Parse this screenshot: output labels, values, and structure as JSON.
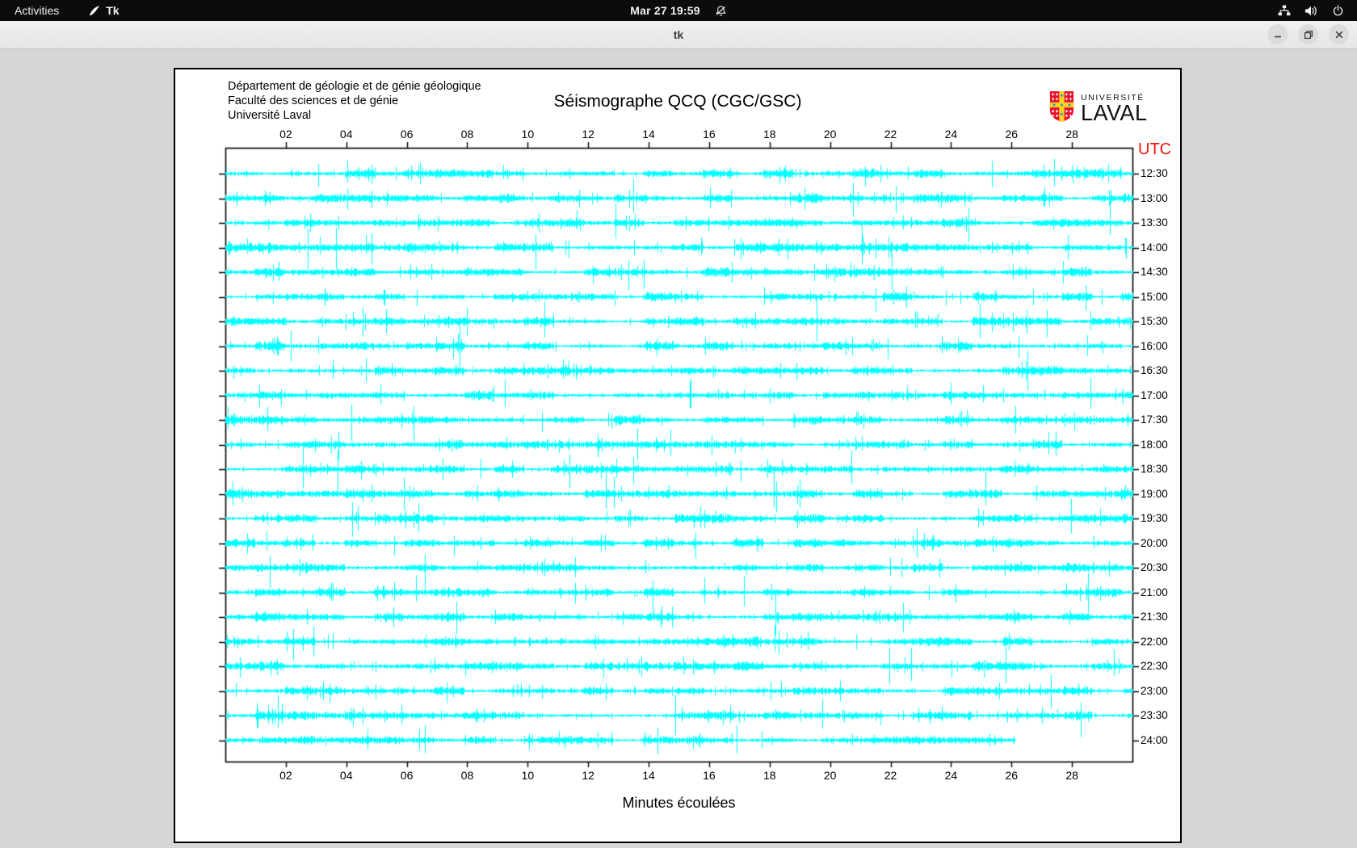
{
  "colors": {
    "trace": "#00ffff",
    "utc": "#f5120c",
    "logo_red": "#e8112d",
    "logo_gold": "#ffd21e",
    "logo_blue": "#2aa0d8",
    "topbar_bg": "#0c0c0c"
  },
  "top_bar": {
    "activities_label": "Activities",
    "app_label": "Tk",
    "clock": "Mar 27  19:59"
  },
  "titlebar": {
    "title": "tk"
  },
  "header": {
    "lines": [
      "Département de géologie et de génie géologique",
      "Faculté des sciences et de génie",
      "Université Laval"
    ],
    "logo_top": "UNIVERSITÉ",
    "logo_bottom": "LAVAL"
  },
  "chart_data": {
    "type": "line",
    "subtype": "helicorder-seismogram",
    "title": "Séismographe QCQ (CGC/GSC)",
    "xlabel": "Minutes écoulées",
    "right_axis_title": "UTC",
    "x_range": [
      0,
      30
    ],
    "x_ticks": [
      "02",
      "04",
      "06",
      "08",
      "10",
      "12",
      "14",
      "16",
      "18",
      "20",
      "22",
      "24",
      "26",
      "28"
    ],
    "row_labels": [
      "12:30",
      "13:00",
      "13:30",
      "14:00",
      "14:30",
      "15:00",
      "15:30",
      "16:00",
      "16:30",
      "17:00",
      "17:30",
      "18:00",
      "18:30",
      "19:00",
      "19:30",
      "20:00",
      "20:30",
      "21:00",
      "21:30",
      "22:00",
      "22:30",
      "23:00",
      "23:30",
      "24:00"
    ],
    "last_row_end_minute": 26.1,
    "grid": false,
    "trace_color": "#00ffff",
    "seed": 20250327
  }
}
